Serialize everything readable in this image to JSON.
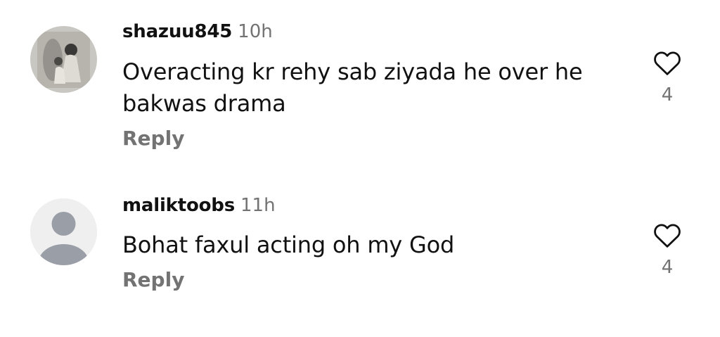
{
  "comments": [
    {
      "username": "shazuu845",
      "time": "10h",
      "text": "Overacting kr rehy sab ziyada he over he bakwas drama",
      "reply_label": "Reply",
      "likes": "4",
      "avatar": "photo"
    },
    {
      "username": "maliktoobs",
      "time": "11h",
      "text": "Bohat faxul acting oh my God",
      "reply_label": "Reply",
      "likes": "4",
      "avatar": "default-user-icon"
    }
  ],
  "colors": {
    "primary_text": "#111111",
    "secondary_text": "#737373",
    "default_avatar_bg": "#efefef",
    "default_avatar_fg": "#9a9ea6"
  }
}
